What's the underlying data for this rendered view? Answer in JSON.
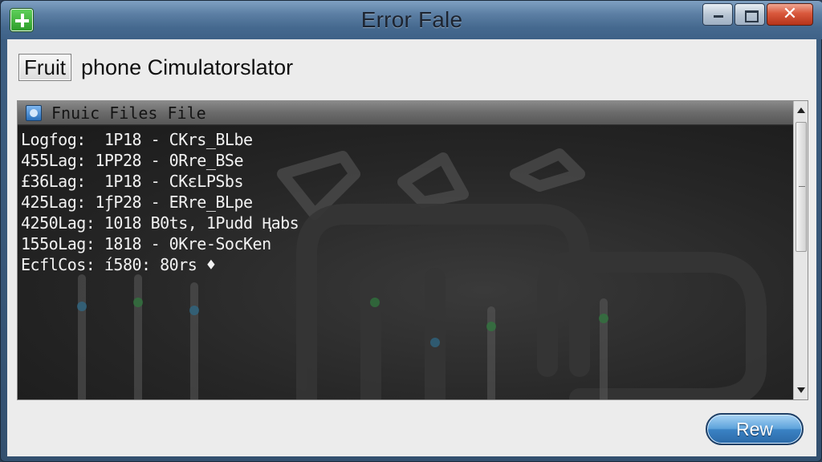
{
  "window": {
    "title": "Error Fale",
    "icon": "plus-icon",
    "close_glyph": "✕"
  },
  "toolbar": {
    "fruit_button_label": "Fruit",
    "app_label": "phone Cimulatorslator"
  },
  "panel": {
    "icon": "image-icon",
    "title": "Fnuic Files File",
    "log_lines": [
      "Logfog:  1P18 - CKrs_BLbe",
      "455Lag: 1PP28 - 0Rre_BSe",
      "£36Lag:  1P18 - CKɛLPSbs",
      "425Lag: 1ƒP28 - ERre_BLpe",
      "4250Lag: 1018 B0ts, 1Pudd Ⱨabs",
      "155oLag: 1818 - 0Kre-SocKen",
      "EcflCos: í580: 80rs ♦"
    ]
  },
  "footer": {
    "rew_button_label": "Rew"
  },
  "colors": {
    "title_bar": "#4f7399",
    "log_background": "#262626",
    "log_text": "#f2f2f2",
    "accent_button": "#3a82c4",
    "close_button": "#d9583c"
  }
}
